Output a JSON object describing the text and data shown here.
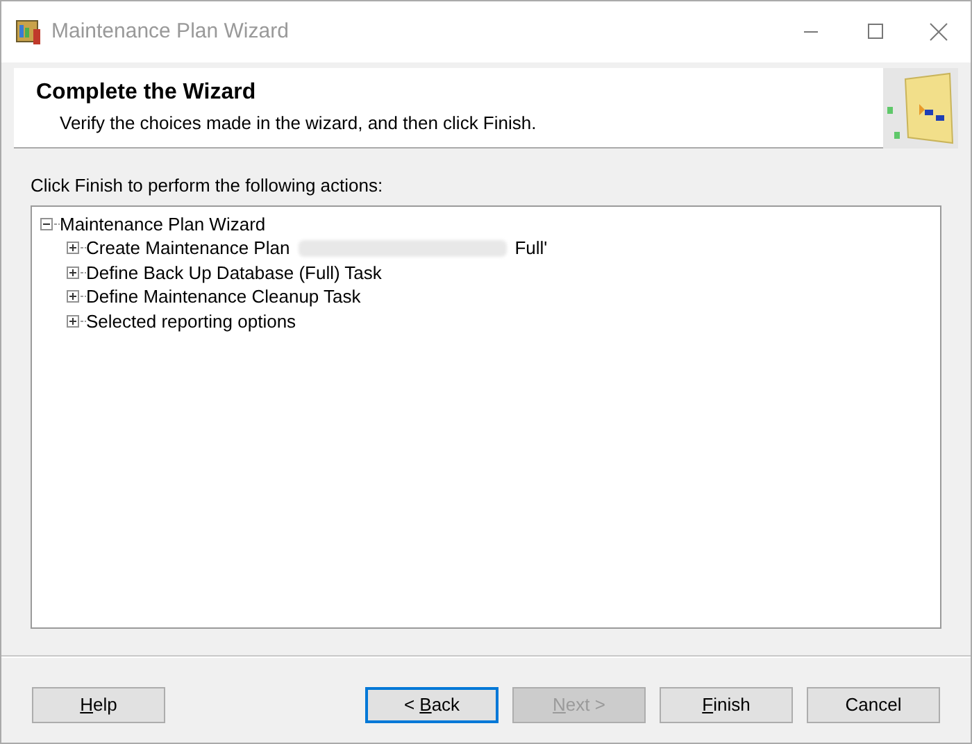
{
  "window": {
    "title": "Maintenance Plan Wizard"
  },
  "header": {
    "title": "Complete the Wizard",
    "subtitle": "Verify the choices made in the wizard, and then click Finish."
  },
  "instruction": "Click Finish to perform the following actions:",
  "tree": [
    {
      "label": "Maintenance Plan Wizard",
      "expanded": true,
      "children": [
        {
          "label": "Create Maintenance Plan",
          "redacted": true,
          "label_end": "Full'",
          "expanded": false
        },
        {
          "label": "Define Back Up Database (Full) Task",
          "expanded": false
        },
        {
          "label": "Define Maintenance Cleanup Task",
          "expanded": false
        },
        {
          "label": "Selected reporting options",
          "expanded": false
        }
      ]
    }
  ],
  "buttons": [
    {
      "key": "H",
      "post": "elp",
      "focused": false,
      "disabled": false
    },
    {
      "pre": "< ",
      "key": "B",
      "post": "ack",
      "focused": true,
      "disabled": false
    },
    {
      "key": "N",
      "post": "ext >",
      "focused": false,
      "disabled": true
    },
    {
      "key": "F",
      "post": "inish",
      "focused": false,
      "disabled": false
    },
    {
      "post": "Cancel",
      "focused": false,
      "disabled": false
    }
  ]
}
